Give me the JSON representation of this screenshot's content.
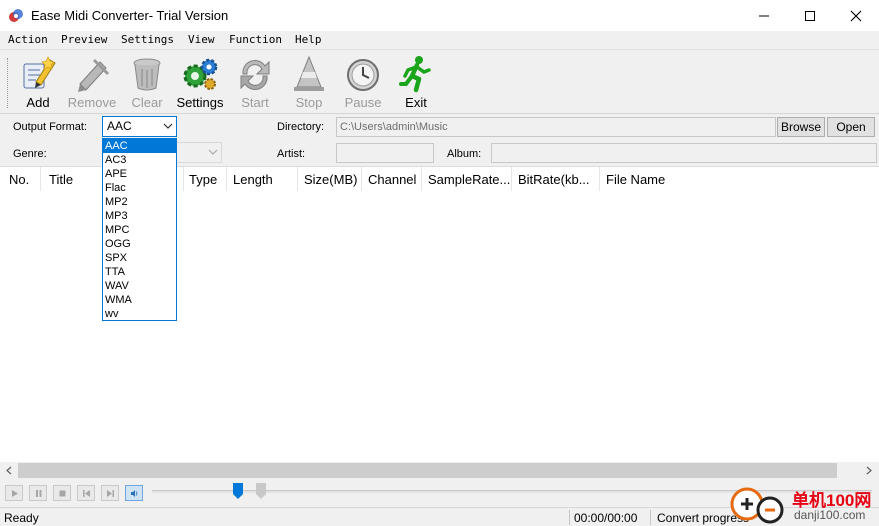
{
  "window": {
    "title": "Ease Midi Converter- Trial Version"
  },
  "menu": [
    "Action",
    "Preview",
    "Settings",
    "View",
    "Function",
    "Help"
  ],
  "toolbar": [
    {
      "label": "Add",
      "icon": "add-pencil-icon",
      "enabled": true
    },
    {
      "label": "Remove",
      "icon": "remove-icon",
      "enabled": false
    },
    {
      "label": "Clear",
      "icon": "clear-trash-icon",
      "enabled": false
    },
    {
      "label": "Settings",
      "icon": "settings-gears-icon",
      "enabled": true
    },
    {
      "label": "Start",
      "icon": "start-arrows-icon",
      "enabled": false
    },
    {
      "label": "Stop",
      "icon": "stop-cone-icon",
      "enabled": false
    },
    {
      "label": "Pause",
      "icon": "pause-clock-icon",
      "enabled": false
    },
    {
      "label": "Exit",
      "icon": "exit-running-man-icon",
      "enabled": true
    }
  ],
  "form": {
    "output_format_label": "Output Format:",
    "output_format_value": "AAC",
    "directory_label": "Directory:",
    "directory_value": "C:\\Users\\admin\\Music",
    "browse_label": "Browse",
    "open_label": "Open",
    "genre_label": "Genre:",
    "artist_label": "Artist:",
    "album_label": "Album:"
  },
  "format_options": [
    "AAC",
    "AC3",
    "APE",
    "Flac",
    "MP2",
    "MP3",
    "MPC",
    "OGG",
    "SPX",
    "TTA",
    "WAV",
    "WMA",
    "wv"
  ],
  "columns": [
    "No.",
    "Title",
    "Type",
    "Length",
    "Size(MB)",
    "Channel",
    "SampleRate...",
    "BitRate(kb...",
    "File Name"
  ],
  "status": {
    "ready": "Ready",
    "time": "00:00/00:00",
    "progress": "Convert progress"
  },
  "watermark": {
    "cn": "单机100网",
    "url": "danji100.com"
  },
  "colors": {
    "accent": "#0078d7",
    "exit_green": "#1aa51a",
    "watermark_red": "#e60012"
  }
}
